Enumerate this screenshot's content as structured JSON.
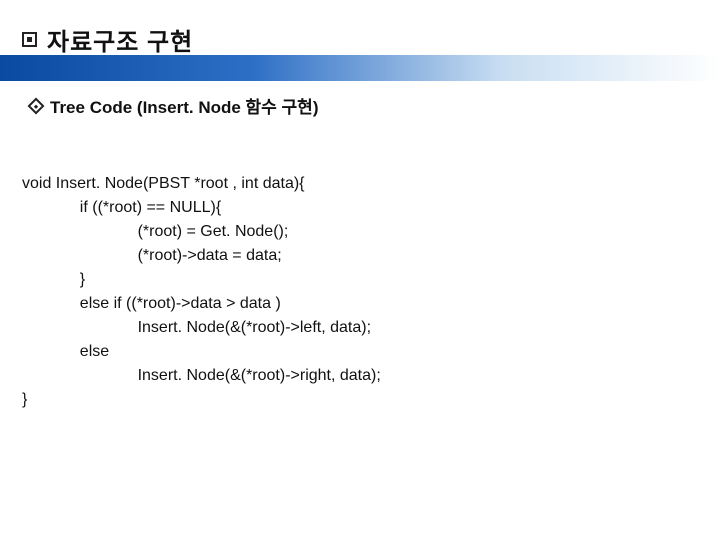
{
  "title": "자료구조 구현",
  "subtitle": "Tree Code (Insert. Node 함수 구현)",
  "code": {
    "l1": "void Insert. Node(PBST *root , int data){",
    "l2": "             if ((*root) == NULL){",
    "l3": "                          (*root) = Get. Node();",
    "l4": "                          (*root)->data = data;",
    "l5": "             }",
    "l6": "             else if ((*root)->data > data )",
    "l7": "                          Insert. Node(&(*root)->left, data);",
    "l8": "             else",
    "l9": "                          Insert. Node(&(*root)->right, data);",
    "l10": "}"
  }
}
